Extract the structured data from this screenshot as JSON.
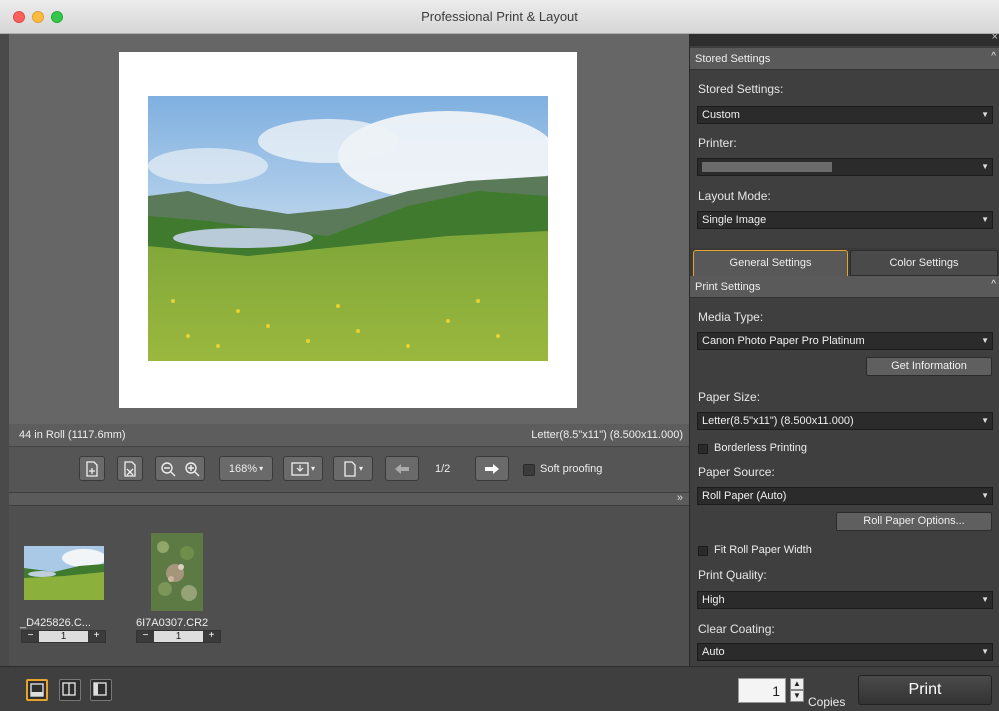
{
  "window": {
    "title": "Professional Print & Layout"
  },
  "preview": {
    "roll_info": "44 in Roll (1117.6mm)",
    "paper_info": "Letter(8.5\"x11\") (8.500x11.000)"
  },
  "toolbar": {
    "zoom_value": "168%",
    "page_indicator": "1/2",
    "soft_proofing_label": "Soft proofing"
  },
  "thumbnails": [
    {
      "filename": "_D425826.C...",
      "copies": "1"
    },
    {
      "filename": "6I7A0307.CR2",
      "copies": "1"
    }
  ],
  "bottom": {
    "copies_value": "1",
    "copies_label": "Copies",
    "print_label": "Print"
  },
  "panel": {
    "stored_section_title": "Stored Settings",
    "stored_settings_label": "Stored Settings:",
    "stored_settings_value": "Custom",
    "printer_label": "Printer:",
    "layout_mode_label": "Layout Mode:",
    "layout_mode_value": "Single Image",
    "tabs": [
      "General Settings",
      "Color Settings"
    ],
    "print_settings_title": "Print Settings",
    "media_type_label": "Media Type:",
    "media_type_value": "Canon Photo Paper Pro Platinum",
    "get_information_label": "Get Information",
    "paper_size_label": "Paper Size:",
    "paper_size_value": "Letter(8.5\"x11\") (8.500x11.000)",
    "borderless_label": "Borderless Printing",
    "paper_source_label": "Paper Source:",
    "paper_source_value": "Roll Paper (Auto)",
    "roll_paper_options_label": "Roll Paper Options...",
    "fit_roll_label": "Fit Roll Paper Width",
    "print_quality_label": "Print Quality:",
    "print_quality_value": "High",
    "clear_coating_label": "Clear Coating:",
    "clear_coating_value": "Auto"
  }
}
